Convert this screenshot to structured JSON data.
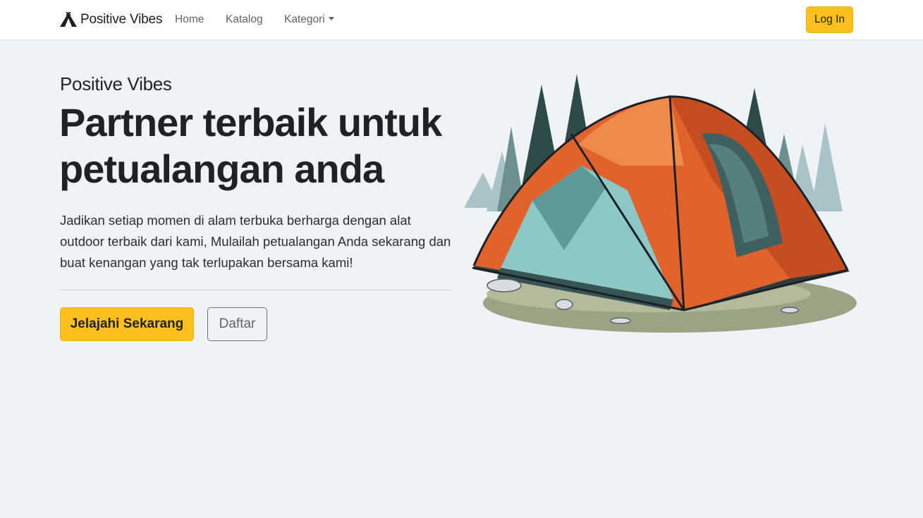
{
  "nav": {
    "brand": "Positive Vibes",
    "links": [
      {
        "label": "Home"
      },
      {
        "label": "Katalog"
      },
      {
        "label": "Kategori"
      }
    ],
    "login_label": "Log In"
  },
  "hero": {
    "eyebrow": "Positive Vibes",
    "headline": "Partner terbaik untuk petualangan anda",
    "lead": "Jadikan setiap momen di alam terbuka berharga dengan alat outdoor terbaik dari kami, Mulailah petualangan Anda sekarang dan buat kenangan yang tak terlupakan bersama kami!",
    "cta_primary": "Jelajahi Sekarang",
    "cta_secondary": "Daftar"
  },
  "icons": {
    "brand": "tent-logo-icon",
    "dropdown": "caret-down-icon"
  },
  "colors": {
    "accent": "#ffc01e",
    "page_bg": "#eff3f7",
    "text": "#1e2226",
    "muted": "#5f6469"
  }
}
